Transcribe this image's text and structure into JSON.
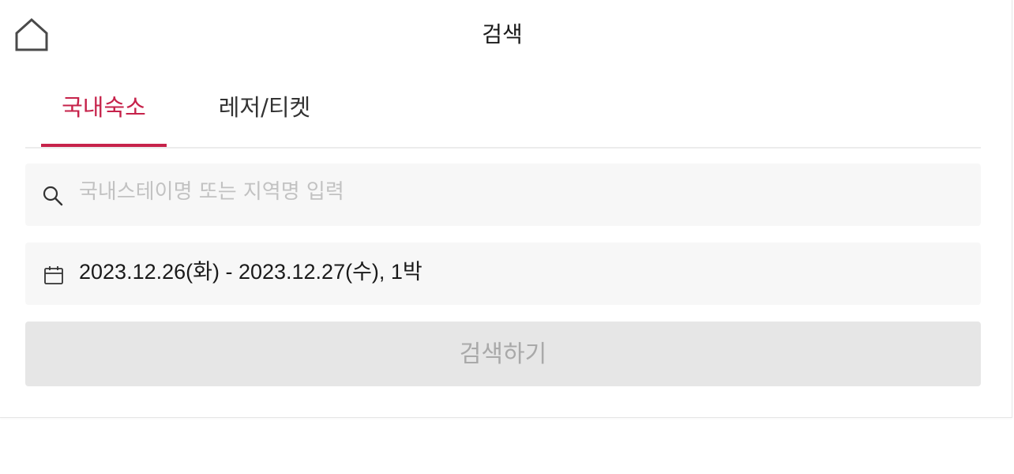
{
  "header": {
    "title": "검색",
    "home_icon": "home-icon"
  },
  "tabs": [
    {
      "label": "국내숙소",
      "active": true
    },
    {
      "label": "레저/티켓",
      "active": false
    }
  ],
  "search": {
    "placeholder": "국내스테이명 또는 지역명 입력",
    "value": "",
    "icon": "search-icon"
  },
  "dates": {
    "text": "2023.12.26(화) - 2023.12.27(수), 1박",
    "icon": "calendar-icon"
  },
  "submit": {
    "label": "검색하기"
  },
  "colors": {
    "accent": "#c6224a",
    "field_bg": "#f7f7f7",
    "button_disabled_bg": "#e6e6e6",
    "button_disabled_text": "#a9a9a9"
  }
}
